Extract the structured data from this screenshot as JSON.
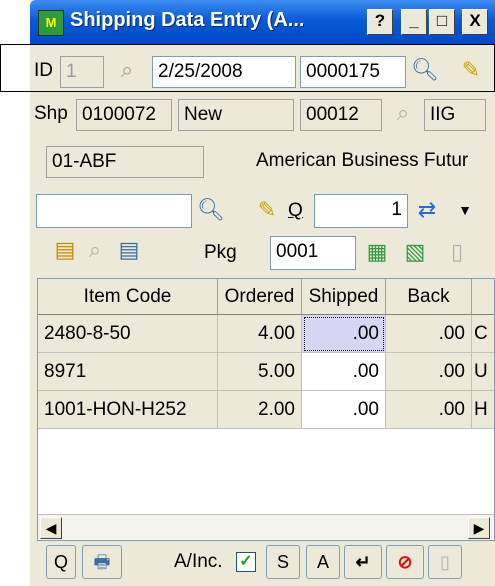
{
  "window": {
    "title": "Shipping Data Entry (A...",
    "help_label": "?",
    "minimize_label": "_",
    "maximize_label": "□",
    "close_label": "X"
  },
  "header": {
    "id_label": "ID",
    "id_value": "1",
    "date_value": "2/25/2008",
    "order_number": "0000175"
  },
  "ship": {
    "shp_label": "Shp",
    "shp_code": "0100072",
    "status": "New",
    "warehouse_code": "00012",
    "warehouse_name": "IIG"
  },
  "customer": {
    "number": "01-ABF",
    "name": "American Business Futur"
  },
  "entry": {
    "item_value": "",
    "q_label": "Q",
    "quantity_value": "1"
  },
  "package": {
    "pkg_label": "Pkg",
    "pkg_value": "0001"
  },
  "grid": {
    "columns": [
      "Item Code",
      "Ordered",
      "Shipped",
      "Back"
    ],
    "rows": [
      {
        "item": "2480-8-50",
        "ordered": "4.00",
        "shipped": ".00",
        "back": ".00",
        "extra": "C"
      },
      {
        "item": "8971",
        "ordered": "5.00",
        "shipped": ".00",
        "back": ".00",
        "extra": "U"
      },
      {
        "item": "1001-HON-H252",
        "ordered": "2.00",
        "shipped": ".00",
        "back": ".00",
        "extra": "H"
      }
    ]
  },
  "toolbar": {
    "q_button": "Q",
    "ainc_label": "A/Inc.",
    "s_button": "S",
    "a_button": "A"
  },
  "colors": {
    "titlebar": "#0a5bd6",
    "window_bg": "#ece9d8",
    "selected_cell": "#d7d7f5"
  }
}
